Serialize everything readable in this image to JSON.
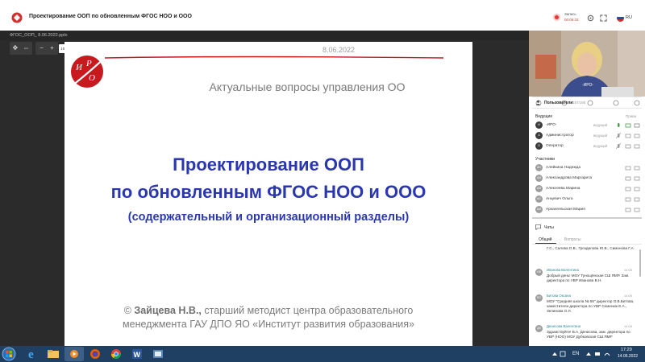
{
  "app": {
    "title": "Проектирование ООП по обновленным ФГОС НОО и ООО",
    "record_label": "Запись",
    "record_time": "00:06:33",
    "language": "RU"
  },
  "presentation": {
    "file_name": "ФГОС_ООП_ 8.06.2022.pptx",
    "zoom": "100%",
    "tools": {
      "move": "✥",
      "fit": "⇔",
      "minus": "−",
      "plus": "+"
    }
  },
  "slide": {
    "logo_text": "И Р О",
    "date": "8.06.2022",
    "subtitle": "Актуальные вопросы управления ОО",
    "heading_line1": "Проектирование ООП",
    "heading_line2": "по обновленным ФГОС НОО и ООО",
    "heading_line3": "(содержательный и организационный разделы)",
    "author_prefix": "© ",
    "author_name": "Зайцева Н.В.,",
    "author_rest": " старший методист центра образовательного",
    "author_line2": "менеджмента ГАУ ДПО ЯО «Институт развития образования»"
  },
  "video": {
    "name": "-ИРО-"
  },
  "users": {
    "header": "Пользователи",
    "count": "187/195",
    "moderators_title": "Ведущие",
    "rights_label": "Права",
    "moderators": [
      {
        "initials": "И",
        "name": "-ИРО-",
        "role": "ведущий"
      },
      {
        "initials": "А",
        "name": "Администратор",
        "role": "ведущий"
      },
      {
        "initials": "О",
        "name": "Оператор",
        "role": "ведущий"
      }
    ],
    "participants_title": "Участники",
    "participants": [
      {
        "initials": "АН",
        "name": "Алейкина Надежда"
      },
      {
        "initials": "АМ",
        "name": "Александрова Маргарита"
      },
      {
        "initials": "АМ",
        "name": "Алексеева Марина"
      },
      {
        "initials": "АО",
        "name": "Анцевич Ольга"
      },
      {
        "initials": "АМ",
        "name": "Архангельская Мария"
      }
    ]
  },
  "chat": {
    "header": "Чаты",
    "tabs": [
      "Общий",
      "Вопросы"
    ],
    "top_partial": "Г.С., Салова О.В., Гроздилова Ю.В., Симонова Г.А.",
    "messages": [
      {
        "initials": "ИВ",
        "author": "Иванова Валентина",
        "time": "14:05",
        "text": "Добрый день! МОУ Тунощёнская СШ ЯМР. Зам. директора по УВР Иванова В.Н."
      },
      {
        "initials": "БО",
        "author": "Битова Оксана",
        "time": "14:05",
        "text": "МОУ \"Средняя школа № 55\" директор О.В.Битова, заместители директора по УВР Семенюк Е.А., Зелинова О.Л."
      },
      {
        "initials": "ДВ",
        "author": "Денисова Валентина",
        "time": "14:05",
        "text": "Здравствуйте! В.А. Денисова, зам. директора по УВР (НОО) МОУ Дубковская СШ ЯМР"
      }
    ]
  },
  "taskbar": {
    "language": "EN",
    "time": "17:29",
    "date": "14.06.2022"
  },
  "colors": {
    "slide_heading": "#2a37b0",
    "logo_red": "#c8191f",
    "taskbar": "#1f3f63",
    "record": "#e53935"
  }
}
